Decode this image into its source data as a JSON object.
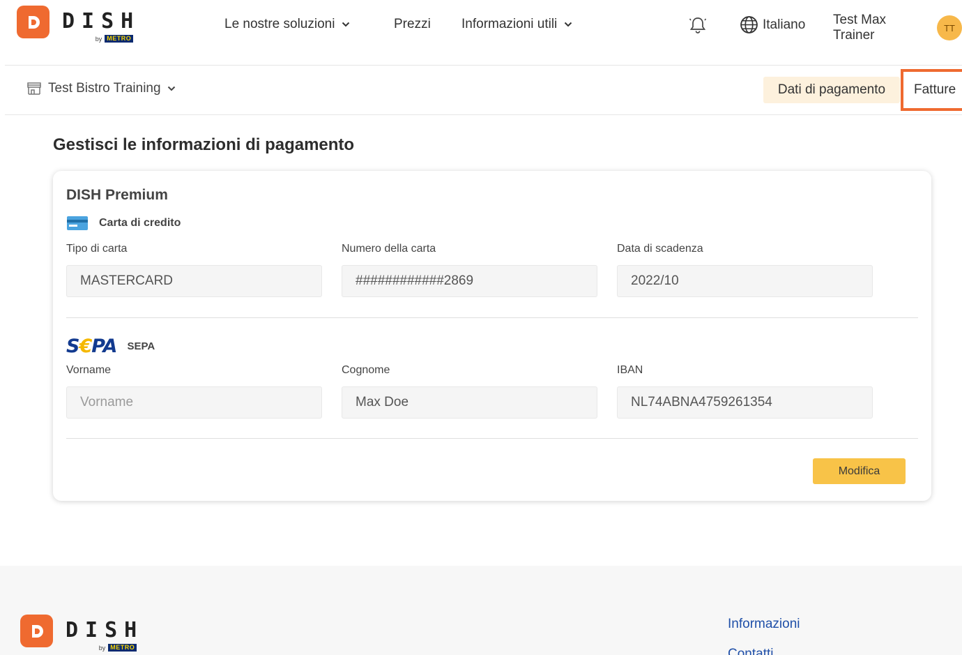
{
  "brand": {
    "logo_word": "DISH",
    "by": "by",
    "metro": "METRO"
  },
  "nav": {
    "solutions": "Le nostre soluzioni",
    "prices": "Prezzi",
    "info": "Informazioni utili",
    "language": "Italiano",
    "user_name": "Test Max Trainer",
    "user_initials": "TT"
  },
  "subnav": {
    "store": "Test Bistro Training",
    "payment_tab": "Dati di pagamento",
    "invoices_tab": "Fatture"
  },
  "page": {
    "title": "Gestisci le informazioni di pagamento"
  },
  "card": {
    "plan": "DISH Premium",
    "credit_card": {
      "heading": "Carta di credito",
      "type_label": "Tipo di carta",
      "type_value": "MASTERCARD",
      "number_label": "Numero della carta",
      "number_value": "############2869",
      "expiry_label": "Data di scadenza",
      "expiry_value": "2022/10"
    },
    "sepa": {
      "logo": "SEPA",
      "heading": "SEPA",
      "firstname_label": "Vorname",
      "firstname_placeholder": "Vorname",
      "lastname_label": "Cognome",
      "lastname_value": "Max Doe",
      "iban_label": "IBAN",
      "iban_value": "NL74ABNA4759261354"
    },
    "edit_button": "Modifica"
  },
  "footer": {
    "info": "Informazioni",
    "contacts": "Contatti"
  },
  "colors": {
    "brand_orange": "#ef6a30",
    "button_yellow": "#f8c348",
    "tab_highlight": "#fdf1dd",
    "link_blue": "#1f4fa8"
  }
}
